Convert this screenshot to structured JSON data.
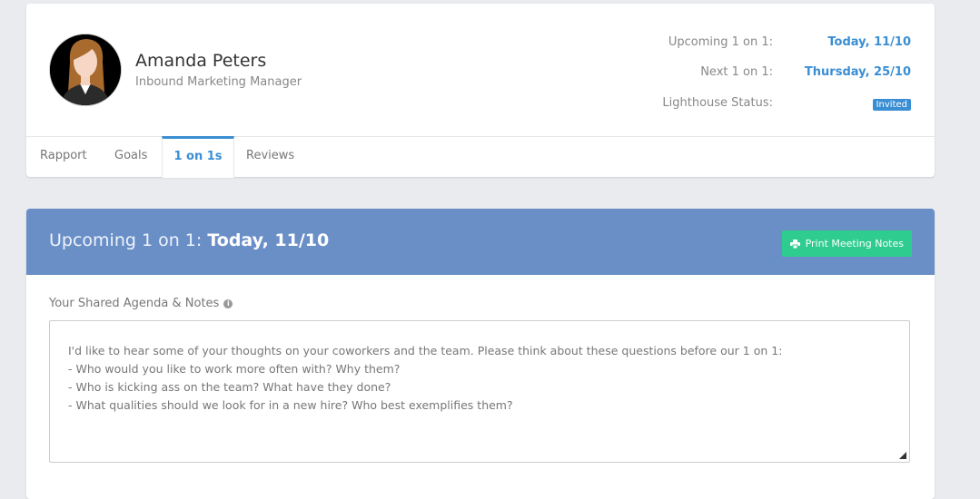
{
  "profile": {
    "name": "Amanda Peters",
    "title": "Inbound Marketing Manager",
    "avatar_icon": "user-avatar",
    "upcoming_label": "Upcoming 1 on 1:",
    "upcoming_value": "Today, 11/10",
    "next_label": "Next 1 on 1:",
    "next_value": "Thursday, 25/10",
    "status_label": "Lighthouse Status:",
    "status_value": "Invited"
  },
  "tabs": [
    {
      "label": "Rapport",
      "active": false
    },
    {
      "label": "Goals",
      "active": false
    },
    {
      "label": "1 on 1s",
      "active": true
    },
    {
      "label": "Reviews",
      "active": false
    }
  ],
  "meeting": {
    "title_prefix": "Upcoming 1 on 1:",
    "title_date": "Today, 11/10",
    "print_label": "Print Meeting Notes",
    "print_icon": "printer-icon",
    "agenda_label": "Your Shared Agenda & Notes",
    "notes": [
      "I'd like to hear some of your thoughts on your coworkers and the team. Please think about these questions before our 1 on 1:",
      "- Who would you like to work more often with? Why them?",
      "- Who is kicking ass on the team? What have they done?",
      "- What qualities should we look for in a new hire? Who best exemplifies them?"
    ]
  },
  "colors": {
    "accent": "#3a8ed4",
    "header_bg": "#6a8fc7",
    "button_green": "#2ecc8f",
    "page_bg": "#e9ebef"
  }
}
